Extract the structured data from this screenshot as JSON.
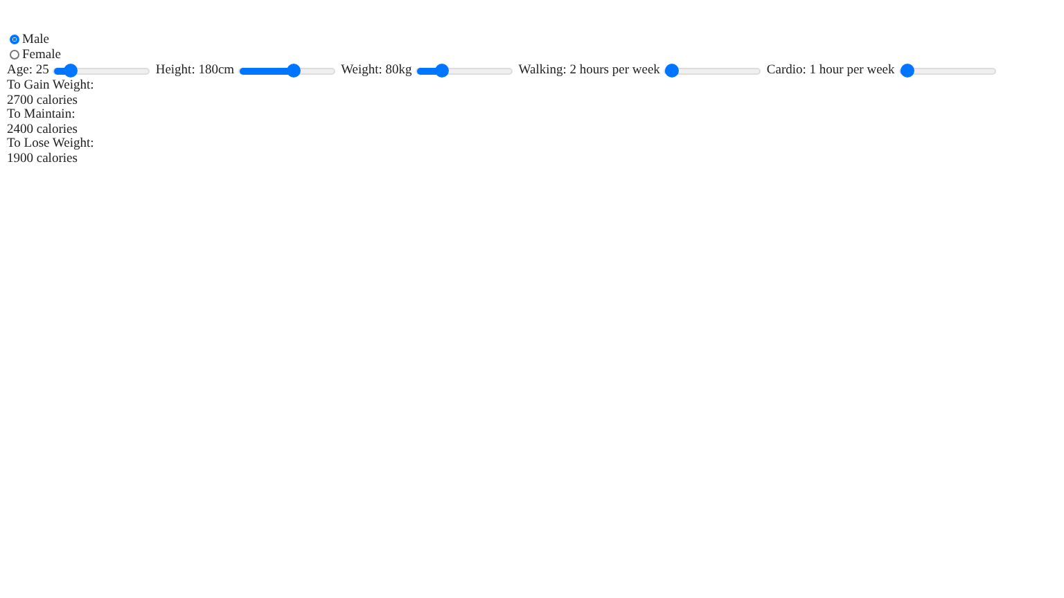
{
  "gender": [
    {
      "label": "Male",
      "selected": true
    },
    {
      "label": "Female",
      "selected": false
    }
  ],
  "sliders": [
    {
      "label": "Age: 25",
      "level": 0.12
    },
    {
      "label": "Height: 180cm",
      "level": 0.59
    },
    {
      "label": "Weight: 80kg",
      "level": 0.22
    },
    {
      "label": "Walking: 2 hours per week",
      "level": 0
    },
    {
      "label": "Cardio: 1 hour per week",
      "level": 0
    }
  ],
  "results": [
    {
      "label": "To Gain Weight:",
      "value": "2700 calories"
    },
    {
      "label": "To Maintain:",
      "value": "2400 calories"
    },
    {
      "label": "To Lose Weight:",
      "value": "1900 calories"
    }
  ]
}
